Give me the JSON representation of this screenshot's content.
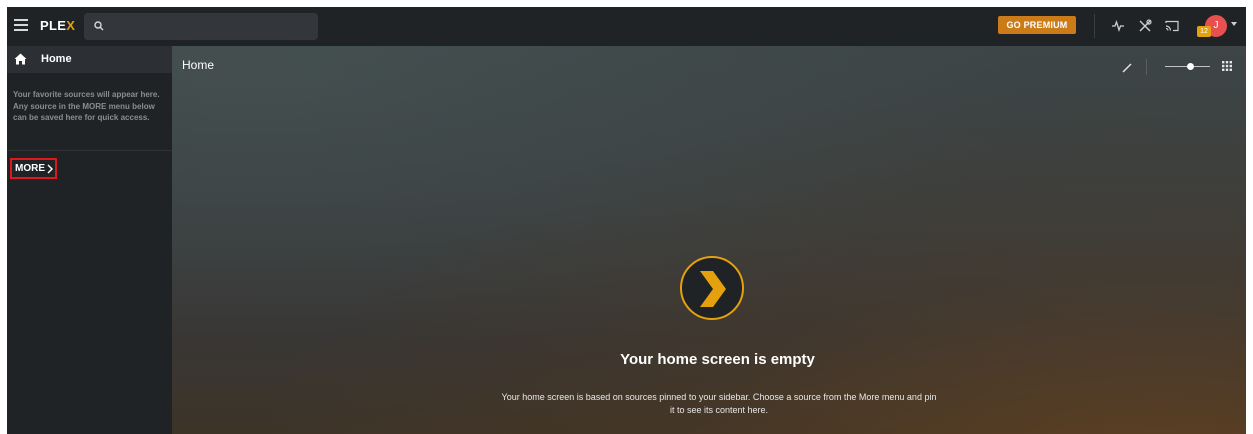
{
  "app": {
    "logo_main": "PLE",
    "logo_accent": "X"
  },
  "topbar": {
    "search_placeholder": "",
    "premium_label": "GO PREMIUM",
    "avatar_initial": "J",
    "notification_count": "12",
    "icons": [
      "activity-icon",
      "tools-icon",
      "cast-icon"
    ]
  },
  "sidebar": {
    "home_label": "Home",
    "note": "Your favorite sources will appear here. Any source in the MORE menu below can be saved here for quick access.",
    "more_label": "MORE"
  },
  "main": {
    "title": "Home",
    "empty_title": "Your home screen is empty",
    "empty_description": "Your home screen is based on sources pinned to your sidebar. Choose a source from the More menu and pin it to see its content here."
  },
  "colors": {
    "accent": "#e5a00d",
    "premium": "#cc7b19",
    "background": "#1f2326",
    "highlight_border": "#e0181e"
  }
}
